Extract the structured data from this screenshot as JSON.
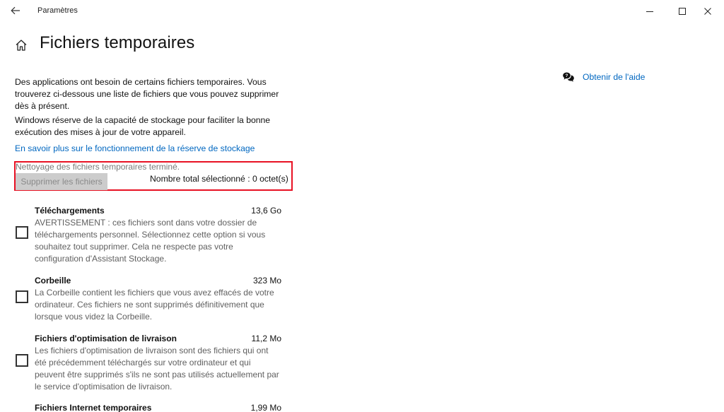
{
  "window": {
    "title": "Paramètres"
  },
  "page": {
    "title": "Fichiers temporaires",
    "description1": "Des applications ont besoin de certains fichiers temporaires. Vous trouverez ci-dessous une liste de fichiers que vous pouvez supprimer dès à présent.",
    "description2": "Windows réserve de la capacité de stockage pour faciliter la bonne exécution des mises à jour de votre appareil.",
    "learn_more_link": "En savoir plus sur le fonctionnement de la réserve de stockage"
  },
  "cleanup": {
    "status": "Nettoyage des fichiers temporaires terminé.",
    "delete_button": "Supprimer les fichiers",
    "total_selected": "Nombre total sélectionné : 0 octet(s)"
  },
  "items": [
    {
      "title": "Téléchargements",
      "size": "13,6 Go",
      "description": "AVERTISSEMENT : ces fichiers sont dans votre dossier de téléchargements personnel. Sélectionnez cette option si vous souhaitez tout supprimer. Cela ne respecte pas votre configuration d'Assistant Stockage.",
      "checked": false
    },
    {
      "title": "Corbeille",
      "size": "323 Mo",
      "description": "La Corbeille contient les fichiers que vous avez effacés de votre ordinateur. Ces fichiers ne sont supprimés définitivement que lorsque vous videz la Corbeille.",
      "checked": false
    },
    {
      "title": "Fichiers d'optimisation de livraison",
      "size": "11,2 Mo",
      "description": "Les fichiers d'optimisation de livraison sont des fichiers qui ont été précédemment téléchargés sur votre ordinateur et qui peuvent être supprimés s'ils ne sont pas utilisés actuellement par le service d'optimisation de livraison.",
      "checked": false
    },
    {
      "title": "Fichiers Internet temporaires",
      "size": "1,99 Mo",
      "description": "",
      "checked": false
    }
  ],
  "help": {
    "link": "Obtenir de l'aide"
  },
  "colors": {
    "link": "#0067c0",
    "highlight": "#e81123",
    "disabled_button_bg": "#cccccc"
  },
  "icons": {
    "back": "arrow-left-icon",
    "home": "home-icon",
    "help": "chat-help-icon",
    "minimize": "minimize-icon",
    "maximize": "maximize-icon",
    "close": "close-icon"
  }
}
